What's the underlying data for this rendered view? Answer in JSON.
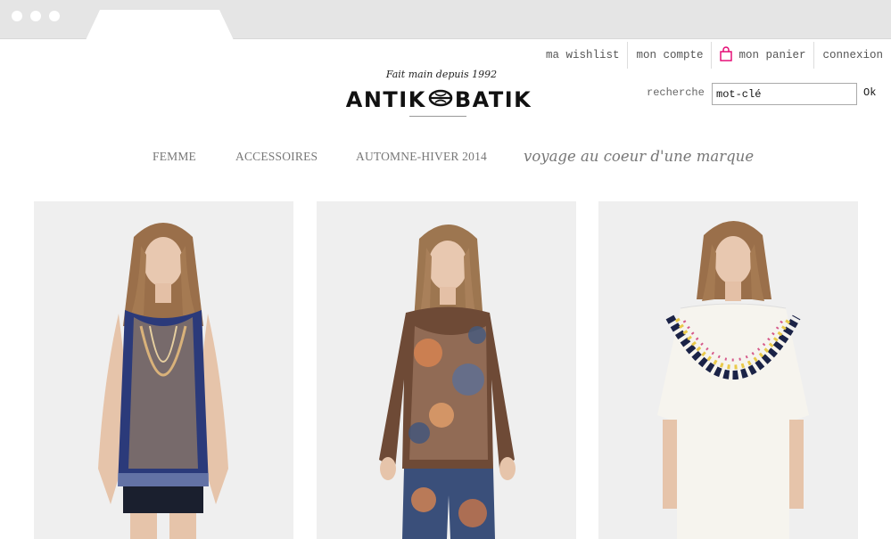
{
  "header": {
    "links": [
      {
        "label": "ma wishlist"
      },
      {
        "label": "mon compte"
      },
      {
        "label": "mon panier",
        "icon": "shopping-bag-icon"
      },
      {
        "label": "connexion"
      }
    ],
    "accent_color": "#e4006f",
    "logo": {
      "tagline": "Fait main depuis 1992",
      "text_left": "ANTIK",
      "text_right": "BATIK"
    },
    "search": {
      "label": "recherche",
      "value": "mot-clé",
      "submit_label": "Ok"
    }
  },
  "nav": {
    "items": [
      {
        "label": "FEMME"
      },
      {
        "label": "ACCESSOIRES"
      },
      {
        "label": "AUTOMNE-HIVER 2014"
      }
    ],
    "voyage_label": "voyage au coeur d'une marque"
  },
  "products": [
    {
      "name": "product-1",
      "image": "model-in-blue-embroidered-tank-top"
    },
    {
      "name": "product-2",
      "image": "model-in-paisley-print-blouse"
    },
    {
      "name": "product-3",
      "image": "model-in-white-embroidered-tunic"
    }
  ]
}
